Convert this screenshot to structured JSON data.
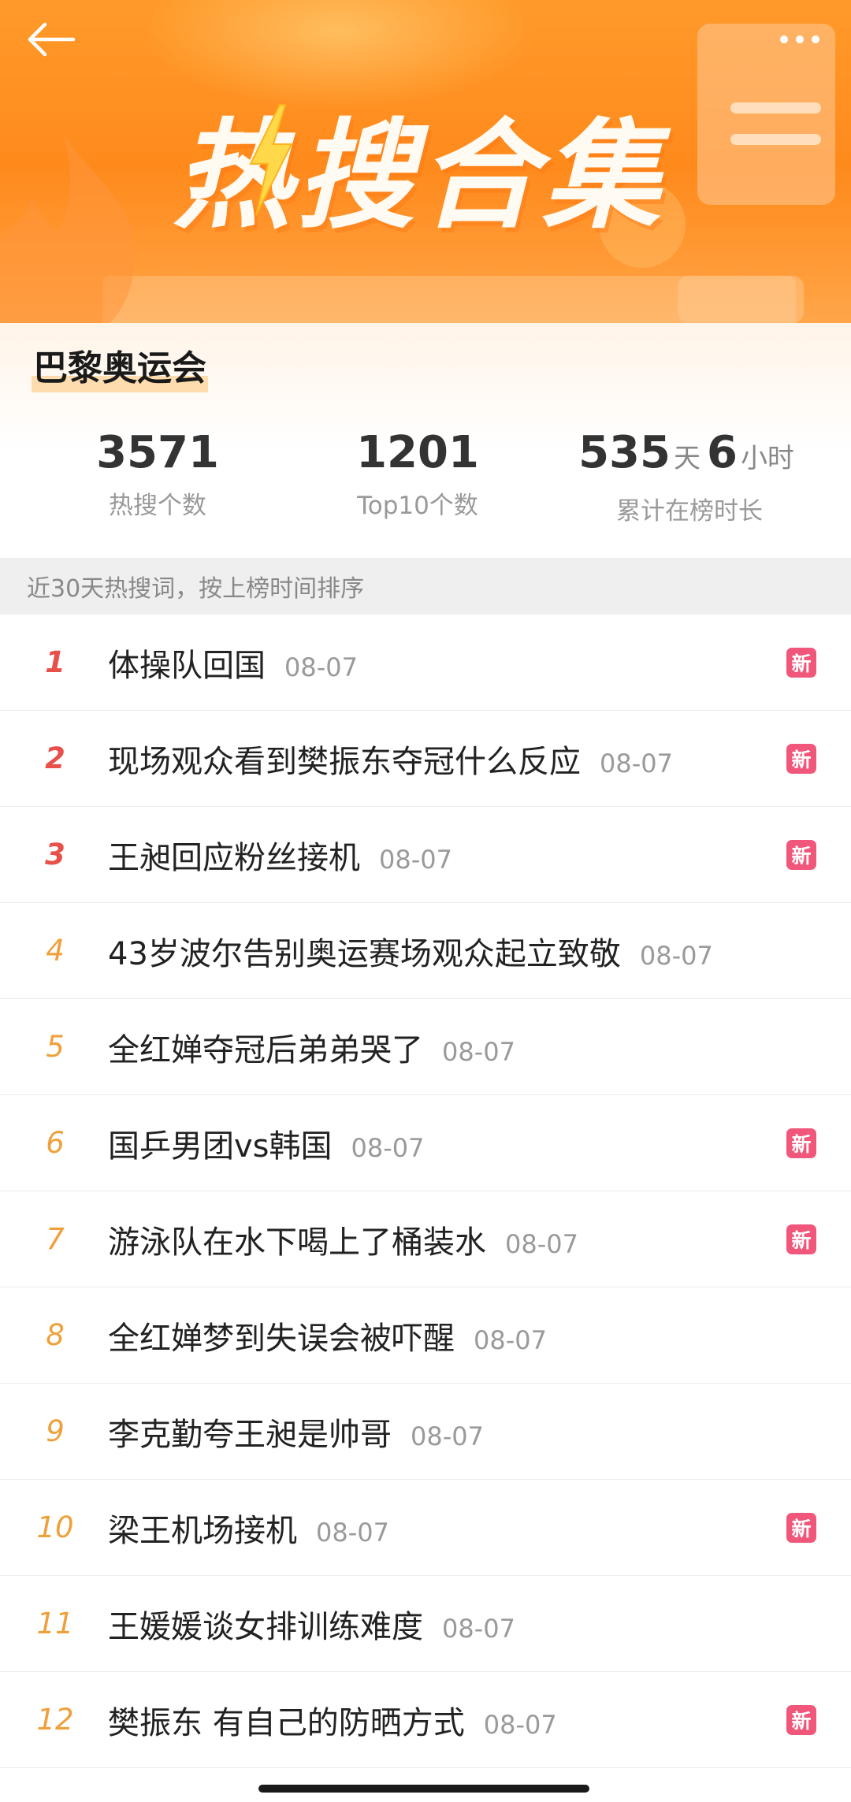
{
  "header": {
    "banner_title": "热搜合集",
    "back_icon": "arrow-left-icon",
    "more_icon": "more-dots-icon",
    "colors": {
      "banner": "#ff8a1c",
      "text": "#fffaf2"
    }
  },
  "topic": {
    "name": "巴黎奥运会",
    "stats": [
      {
        "value": "3571",
        "label": "热搜个数"
      },
      {
        "value": "1201",
        "label": "Top10个数"
      },
      {
        "days": "535",
        "days_unit": "天",
        "hours": "6",
        "hours_unit": "小时",
        "label": "累计在榜时长"
      }
    ]
  },
  "section_note": "近30天热搜词，按上榜时间排序",
  "new_badge": "新",
  "colors": {
    "rank_top": "#e8504a",
    "rank_rest": "#f0a03a",
    "new_badge": "#f0577a"
  },
  "items": [
    {
      "rank": "1",
      "title": "体操队回国",
      "date": "08-07",
      "is_new": true
    },
    {
      "rank": "2",
      "title": "现场观众看到樊振东夺冠什么反应",
      "date": "08-07",
      "is_new": true
    },
    {
      "rank": "3",
      "title": "王昶回应粉丝接机",
      "date": "08-07",
      "is_new": true
    },
    {
      "rank": "4",
      "title": "43岁波尔告别奥运赛场观众起立致敬",
      "date": "08-07",
      "is_new": false
    },
    {
      "rank": "5",
      "title": "全红婵夺冠后弟弟哭了",
      "date": "08-07",
      "is_new": false
    },
    {
      "rank": "6",
      "title": "国乒男团vs韩国",
      "date": "08-07",
      "is_new": true
    },
    {
      "rank": "7",
      "title": "游泳队在水下喝上了桶装水",
      "date": "08-07",
      "is_new": true
    },
    {
      "rank": "8",
      "title": "全红婵梦到失误会被吓醒",
      "date": "08-07",
      "is_new": false
    },
    {
      "rank": "9",
      "title": "李克勤夸王昶是帅哥",
      "date": "08-07",
      "is_new": false
    },
    {
      "rank": "10",
      "title": "梁王机场接机",
      "date": "08-07",
      "is_new": true
    },
    {
      "rank": "11",
      "title": "王媛媛谈女排训练难度",
      "date": "08-07",
      "is_new": false
    },
    {
      "rank": "12",
      "title": "樊振东 有自己的防晒方式",
      "date": "08-07",
      "is_new": true
    }
  ]
}
